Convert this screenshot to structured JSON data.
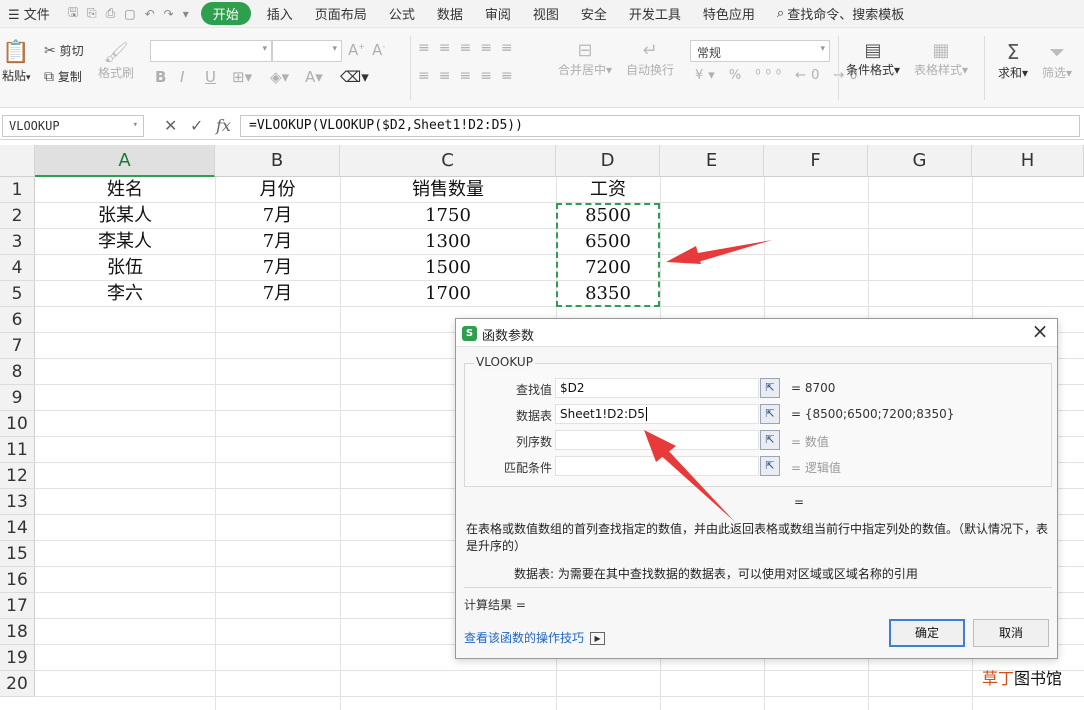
{
  "menubar": {
    "file": "文件",
    "start": "开始",
    "tabs": [
      "插入",
      "页面布局",
      "公式",
      "数据",
      "审阅",
      "视图",
      "安全",
      "开发工具",
      "特色应用"
    ],
    "search": "查找命令、搜索模板"
  },
  "ribbon": {
    "paste": "粘贴",
    "cut": "剪切",
    "copy": "复制",
    "format_painter": "格式刷",
    "number_format": "常规",
    "merge_center": "合并居中",
    "wrap_text": "自动换行",
    "conditional_format": "条件格式",
    "table_style": "表格样式",
    "sum": "求和",
    "filter": "筛选"
  },
  "formula_bar": {
    "name_box": "VLOOKUP",
    "formula": "=VLOOKUP(VLOOKUP($D2,Sheet1!D2:D5))"
  },
  "sheet": {
    "columns": [
      "A",
      "B",
      "C",
      "D",
      "E",
      "F",
      "G",
      "H"
    ],
    "selected_column": "A",
    "rows": [
      "1",
      "2",
      "3",
      "4",
      "5",
      "6",
      "7",
      "8",
      "9",
      "10",
      "11",
      "12",
      "13",
      "14",
      "15",
      "16",
      "17",
      "18",
      "19",
      "20"
    ],
    "headers": [
      "姓名",
      "月份",
      "销售数量",
      "工资"
    ],
    "data": [
      [
        "张某人",
        "7月",
        "1750",
        "8500"
      ],
      [
        "李某人",
        "7月",
        "1300",
        "6500"
      ],
      [
        "张伍",
        "7月",
        "1500",
        "7200"
      ],
      [
        "李六",
        "7月",
        "1700",
        "8350"
      ]
    ]
  },
  "dialog": {
    "title": "函数参数",
    "function_name": "VLOOKUP",
    "args": [
      {
        "label": "查找值",
        "value": "$D2",
        "result": "= 8700",
        "placeholder": false
      },
      {
        "label": "数据表",
        "value": "Sheet1!D2:D5",
        "result": "= {8500;6500;7200;8350}",
        "placeholder": false
      },
      {
        "label": "列序数",
        "value": "",
        "result": "= 数值",
        "placeholder": true
      },
      {
        "label": "匹配条件",
        "value": "",
        "result": "= 逻辑值",
        "placeholder": true
      }
    ],
    "equals": "=",
    "description": "在表格或数值数组的首列查找指定的数值，并由此返回表格或数组当前行中指定列处的数值。（默认情况下，表是升序的）",
    "param_desc": "数据表:  为需要在其中查找数据的数据表，可以使用对区域或区域名称的引用",
    "calc_result": "计算结果 =",
    "tips": "查看该函数的操作技巧",
    "ok": "确定",
    "cancel": "取消"
  },
  "watermark": {
    "a": "草丁",
    "b": "图书馆"
  },
  "colors": {
    "accent": "#2e9e4f",
    "arrow": "#e83a3a",
    "link": "#1e64c8"
  }
}
